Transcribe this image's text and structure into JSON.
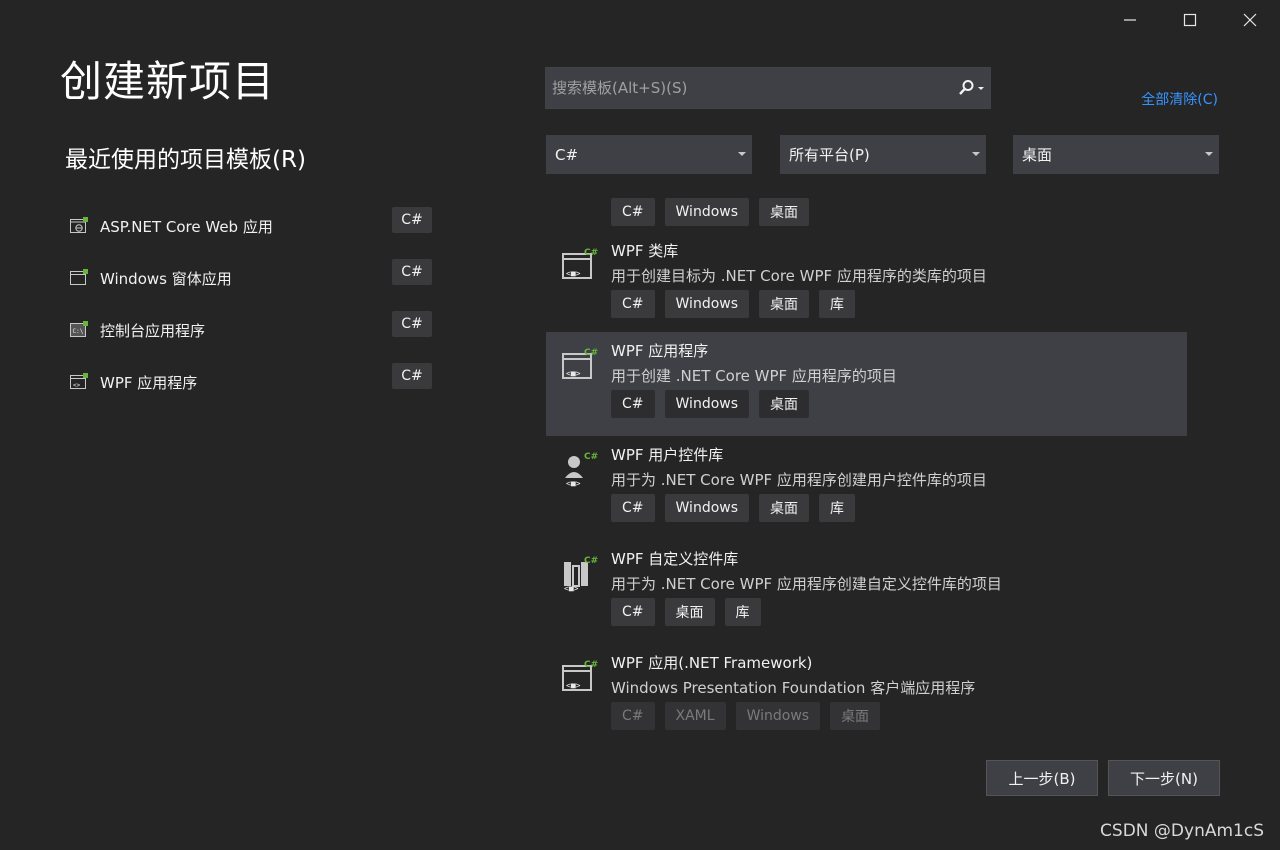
{
  "window": {
    "minimize_icon": "minimize-icon",
    "maximize_icon": "maximize-icon",
    "close_icon": "close-icon"
  },
  "page_title": "创建新项目",
  "recent": {
    "heading": "最近使用的项目模板(R)",
    "items": [
      {
        "label": "ASP.NET Core Web 应用",
        "lang": "C#",
        "icon": "web-app-icon"
      },
      {
        "label": "Windows 窗体应用",
        "lang": "C#",
        "icon": "window-form-icon"
      },
      {
        "label": "控制台应用程序",
        "lang": "C#",
        "icon": "console-icon"
      },
      {
        "label": "WPF 应用程序",
        "lang": "C#",
        "icon": "wpf-app-icon"
      }
    ]
  },
  "search": {
    "placeholder": "搜索模板(Alt+S)(S)",
    "value": "",
    "icon": "search-icon"
  },
  "clear_all": "全部清除(C)",
  "filters": {
    "language": "C#",
    "platform": "所有平台(P)",
    "project_type": "桌面"
  },
  "templates": [
    {
      "title": "",
      "desc": "",
      "tags": [
        "C#",
        "Windows",
        "桌面"
      ],
      "partial": true
    },
    {
      "title": "WPF 类库",
      "desc": "用于创建目标为 .NET Core WPF 应用程序的类库的项目",
      "tags": [
        "C#",
        "Windows",
        "桌面",
        "库"
      ],
      "icon": "wpf-class-library-icon"
    },
    {
      "title": "WPF 应用程序",
      "desc": "用于创建 .NET Core WPF 应用程序的项目",
      "tags": [
        "C#",
        "Windows",
        "桌面"
      ],
      "icon": "wpf-app-icon",
      "selected": true
    },
    {
      "title": "WPF 用户控件库",
      "desc": "用于为 .NET Core WPF 应用程序创建用户控件库的项目",
      "tags": [
        "C#",
        "Windows",
        "桌面",
        "库"
      ],
      "icon": "wpf-user-control-library-icon"
    },
    {
      "title": "WPF 自定义控件库",
      "desc": "用于为 .NET Core WPF 应用程序创建自定义控件库的项目",
      "tags": [
        "C#",
        "桌面",
        "库"
      ],
      "icon": "wpf-custom-control-library-icon"
    },
    {
      "title": "WPF 应用(.NET Framework)",
      "desc": "Windows Presentation Foundation 客户端应用程序",
      "tags": [
        "C#",
        "XAML",
        "Windows",
        "桌面"
      ],
      "icon": "wpf-app-framework-icon"
    }
  ],
  "buttons": {
    "back": "上一步(B)",
    "next": "下一步(N)"
  },
  "watermark": "CSDN @DynAm1cS",
  "colors": {
    "background": "#252526",
    "accent_link": "#3794ff",
    "selected_row": "#3f3f46",
    "csharp_badge": "#68b53c"
  }
}
